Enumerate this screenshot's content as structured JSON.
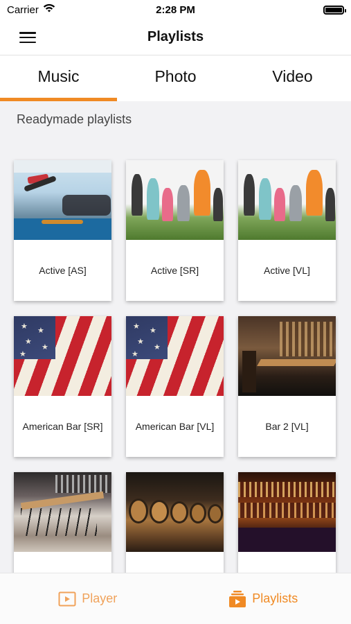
{
  "status_bar": {
    "carrier": "Carrier",
    "time": "2:28 PM",
    "wifi_icon": "wifi-icon",
    "battery_icon": "battery-icon"
  },
  "nav": {
    "title": "Playlists",
    "menu_icon": "hamburger-menu-icon"
  },
  "tabs": [
    {
      "label": "Music",
      "active": true
    },
    {
      "label": "Photo",
      "active": false
    },
    {
      "label": "Video",
      "active": false
    }
  ],
  "section": {
    "title": "Readymade playlists"
  },
  "playlists": [
    {
      "label": "Active [AS]",
      "image": "gym"
    },
    {
      "label": "Active [SR]",
      "image": "outdoor"
    },
    {
      "label": "Active [VL]",
      "image": "outdoor"
    },
    {
      "label": "American Bar [SR]",
      "image": "flag"
    },
    {
      "label": "American Bar [VL]",
      "image": "flag"
    },
    {
      "label": "Bar 2 [VL]",
      "image": "bar"
    },
    {
      "label": "",
      "image": "barstools"
    },
    {
      "label": "",
      "image": "barrels"
    },
    {
      "label": "",
      "image": "bottles"
    }
  ],
  "bottom_bar": {
    "player_label": "Player",
    "player_icon": "play-icon",
    "playlists_label": "Playlists",
    "playlists_icon": "playlists-icon"
  },
  "colors": {
    "accent": "#f08a24",
    "content_bg": "#f2f2f4"
  }
}
